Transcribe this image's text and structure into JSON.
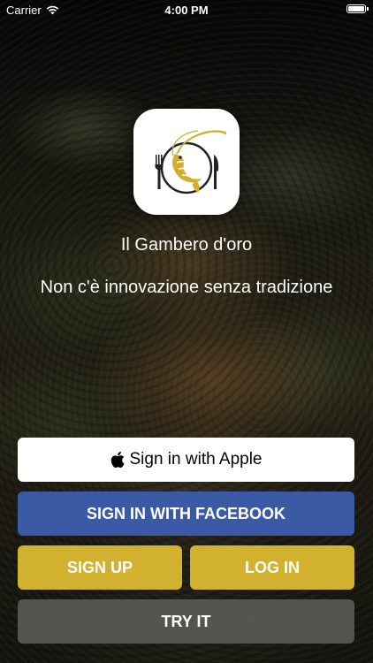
{
  "status_bar": {
    "carrier": "Carrier",
    "time": "4:00 PM"
  },
  "brand": {
    "name": "Il Gambero d'oro",
    "slogan": "Non c'è innovazione senza tradizione",
    "accent": "#d2b12f"
  },
  "buttons": {
    "apple": "Sign in with Apple",
    "facebook": "SIGN IN WITH FACEBOOK",
    "signup": "SIGN UP",
    "login": "LOG IN",
    "try": "TRY IT"
  },
  "colors": {
    "facebook": "#3b5aa6",
    "gold": "#d2b12f",
    "try": "#5f5f5a"
  }
}
